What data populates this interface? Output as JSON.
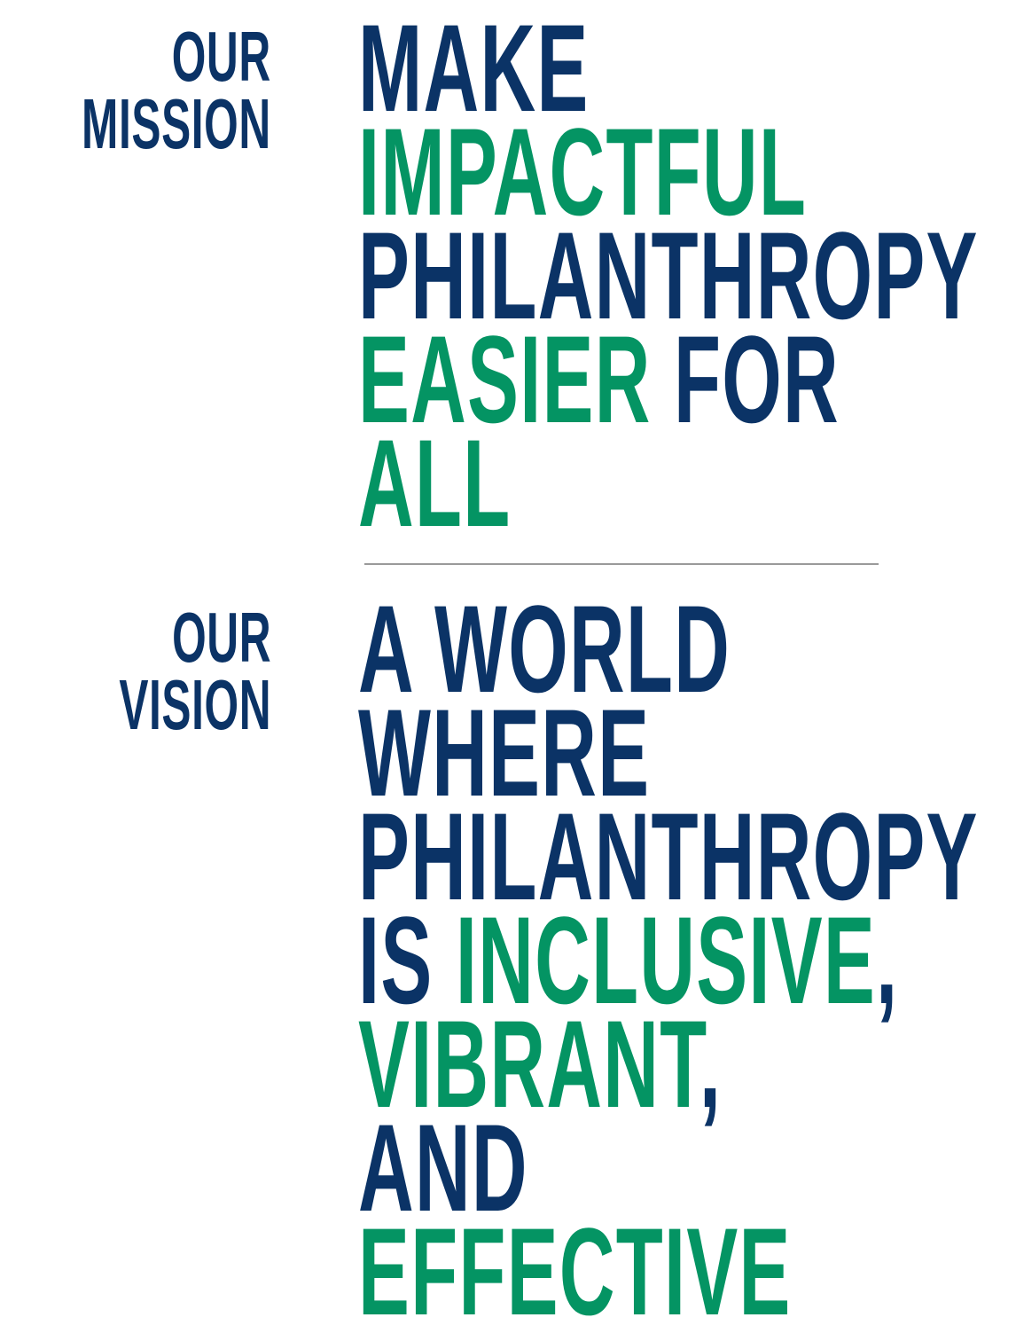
{
  "colors": {
    "navy": "#0b3366",
    "green": "#049463",
    "divider": "#9a9a9a"
  },
  "mission": {
    "label_line1": "OUR",
    "label_line2": "MISSION",
    "statement": {
      "line1": "MAKE",
      "line2": "IMPACTFUL",
      "line3": "PHILANTHROPY",
      "line4a": "EASIER",
      "line4b": " FOR",
      "line5": "ALL"
    }
  },
  "vision": {
    "label_line1": "OUR",
    "label_line2": "VISION",
    "statement": {
      "line1": "A WORLD",
      "line2": "WHERE",
      "line3": "PHILANTHROPY",
      "line4a": "IS ",
      "line4b": "INCLUSIVE",
      "line4c": ",",
      "line5a": "VIBRANT",
      "line5b": ",",
      "line6": "AND",
      "line7": "EFFECTIVE"
    }
  }
}
